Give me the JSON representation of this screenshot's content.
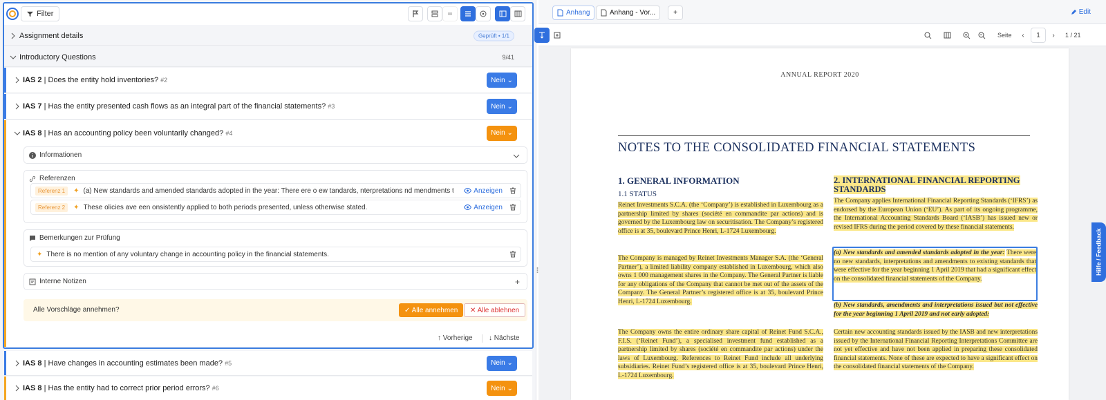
{
  "left": {
    "filter_label": "Filter",
    "sections": {
      "assignment": {
        "label": "Assignment details",
        "badge": "Geprüft • 1/1"
      },
      "intro": {
        "label": "Introductory Questions",
        "count": "9/41"
      }
    },
    "questions": [
      {
        "code": "IAS 2",
        "text": "Does the entity hold inventories?",
        "num": "#2",
        "answer": "Nein"
      },
      {
        "code": "IAS 7",
        "text": "Has the entity presented cash flows as an integral part of the financial statements?",
        "num": "#3",
        "answer": "Nein"
      },
      {
        "code": "IAS 8",
        "text": "Has an accounting policy been voluntarily changed?",
        "num": "#4",
        "answer": "Nein"
      },
      {
        "code": "IAS 8",
        "text": "Have changes in accounting estimates been made?",
        "num": "#5",
        "answer": "Nein"
      },
      {
        "code": "IAS 8",
        "text": "Has the entity had to correct prior period errors?",
        "num": "#6",
        "answer": "Nein"
      }
    ],
    "info_label": "Informationen",
    "refs_label": "Referenzen",
    "references": [
      {
        "tag": "Referenz 1",
        "text": "(a) New standards and amended standards adopted in the year: There ere o ew tandards, nterpretations nd mendments to existing ...",
        "show": "Anzeigen"
      },
      {
        "tag": "Referenz 2",
        "text": "These olicies ave een onsistently applied to both periods presented, unless otherwise stated.",
        "show": "Anzeigen"
      }
    ],
    "remarks_label": "Bemerkungen zur Prüfung",
    "remark_text": "There is no mention of any voluntary change in accounting policy in the financial statements.",
    "internal_notes_label": "Interne Notizen",
    "suggest_label": "Alle Vorschläge annehmen?",
    "accept_all": "✓ Alle annehmen",
    "reject_all": "✕ Alle ablehnen",
    "prev": "Vorherige",
    "next": "Nächste",
    "plus": "+"
  },
  "right": {
    "tabs": [
      "Anhang",
      "Anhang - Vor..."
    ],
    "add_tab": "+",
    "edit": "Edit",
    "page_label": "Seite",
    "page_value": "1",
    "page_total": "1 / 21",
    "help": "Hilfe / Feedback",
    "doc": {
      "header": "ANNUAL REPORT 2020",
      "title": "NOTES TO THE CONSOLIDATED FINANCIAL STATEMENTS",
      "h1": "1. GENERAL INFORMATION",
      "h1sub": "1.1 STATUS",
      "p1": "Reinet Investments S.C.A. (the ‘Company’) is established in Luxembourg as a partnership limited by shares (société en commandite par actions) and is governed by the Luxembourg law on securitisation. The Company’s registered office is at 35, boulevard Prince Henri, L-1724 Luxembourg.",
      "p2": "The Company is managed by Reinet Investments Manager S.A. (the ‘General Partner’), a limited liability company established in Luxembourg, which also owns 1 000 management shares in the Company. The General Partner is liable for any obligations of the Company that cannot be met out of the assets of the Company. The General Partner’s registered office is at 35, boulevard Prince Henri, L-1724 Luxembourg.",
      "p3": "The Company owns the entire ordinary share capital of Reinet Fund S.C.A., F.I.S. (‘Reinet Fund’), a specialised investment fund established as a partnership limited by shares (société en commandite par actions) under the laws of Luxembourg. References to Reinet Fund include all underlying subsidiaries. Reinet Fund’s registered office is at 35, boulevard Prince Henri, L-1724 Luxembourg.",
      "h2": "2. INTERNATIONAL FINANCIAL REPORTING STANDARDS",
      "p4": "The Company applies International Financial Reporting Standards (‘IFRS’) as endorsed by the European Union (‘EU’). As part of its ongoing programme, the International Accounting Standards Board (‘IASB’) has issued new or revised IFRS during the period covered by these financial statements.",
      "p5h": "(a) New standards and amended standards adopted in the year:",
      "p5": "There were no new standards, interpretations and amendments to existing standards that were effective for the year beginning 1 April 2019 that had a significant effect on the consolidated financial statements of the Company.",
      "p6h": "(b) New standards, amendments and interpretations issued but not effective for the year beginning 1 April 2019 and not early adopted:",
      "p6": "Certain new accounting standards issued by the IASB and new interpretations issued by the International Financial Reporting Interpretations Committee are not yet effective and have not been applied in preparing these consolidated financial statements. None of these are expected to have a significant effect on the consolidated financial statements of the Company."
    }
  },
  "colors": {
    "accent": "#2f6fde",
    "orange": "#f4920f",
    "highlight": "#fbe788",
    "title": "#1d3260"
  }
}
